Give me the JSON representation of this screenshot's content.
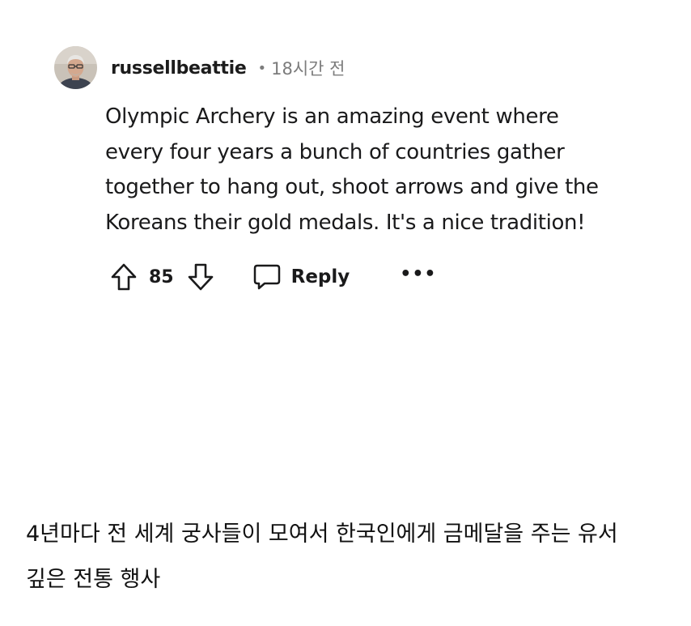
{
  "comment": {
    "author": {
      "username": "russellbeattie",
      "avatar_icon": "user-avatar-photo"
    },
    "separator": "•",
    "timestamp": "18시간 전",
    "body_lines": [
      "Olympic Archery is an amazing event where",
      "every four years a bunch of countries gather",
      "together to hang out, shoot arrows and give the",
      "Koreans their gold medals. It's a nice tradition!"
    ],
    "actions": {
      "upvote_icon": "upvote-arrow-icon",
      "vote_count": "85",
      "downvote_icon": "downvote-arrow-icon",
      "reply_icon": "speech-bubble-icon",
      "reply_label": "Reply",
      "more_label": "•••"
    }
  },
  "caption": {
    "lines": [
      "4년마다 전 세계 궁사들이 모여서 한국인에게 금메달을 주는 유서",
      "깊은 전통 행사"
    ]
  }
}
